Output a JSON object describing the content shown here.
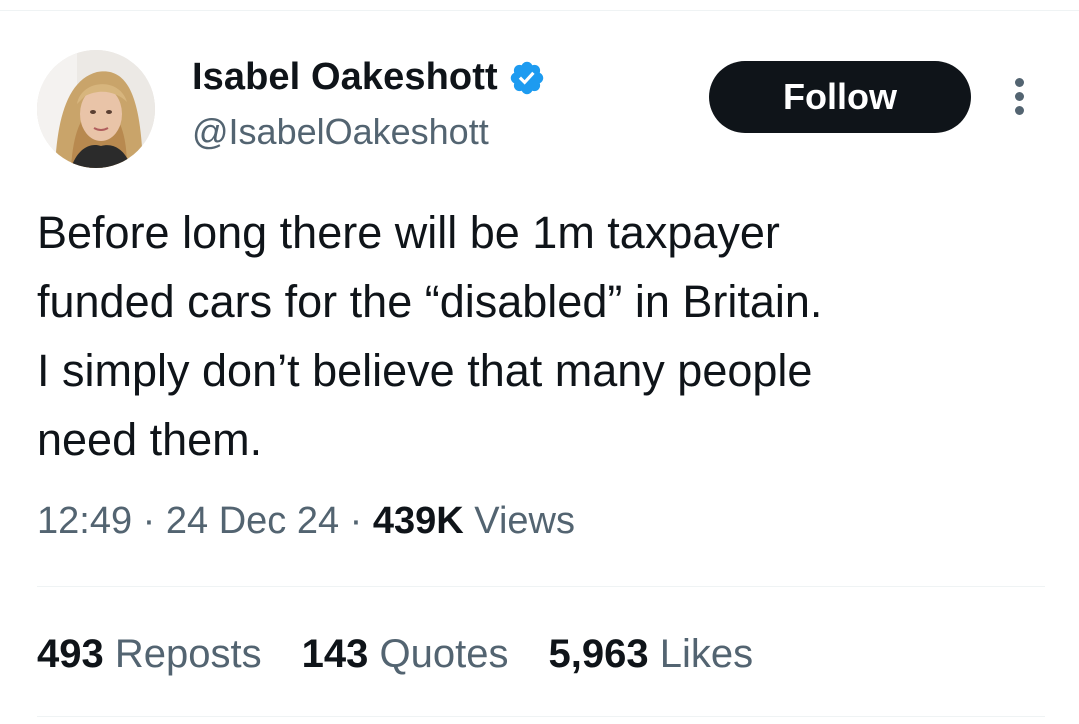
{
  "author": {
    "display_name": "Isabel Oakeshott",
    "handle": "@IsabelOakeshott",
    "verified_icon": "verified-badge-icon",
    "verified_color": "#1d9bf0"
  },
  "follow_label": "Follow",
  "more_icon": "more-vertical-icon",
  "tweet": {
    "lines": [
      "Before long there will be 1m taxpayer",
      "funded cars for the “disabled” in Britain.",
      "I simply don’t believe that many people",
      "need them."
    ]
  },
  "meta": {
    "time": "12:49",
    "separator": "·",
    "date": "24 Dec 24",
    "views_count": "439K",
    "views_label": "Views"
  },
  "stats": {
    "reposts_count": "493",
    "reposts_label": "Reposts",
    "quotes_count": "143",
    "quotes_label": "Quotes",
    "likes_count": "5,963",
    "likes_label": "Likes"
  },
  "colors": {
    "text": "#0f1419",
    "secondary": "#536471",
    "button_bg": "#0f1419",
    "divider": "#eff3f4"
  }
}
